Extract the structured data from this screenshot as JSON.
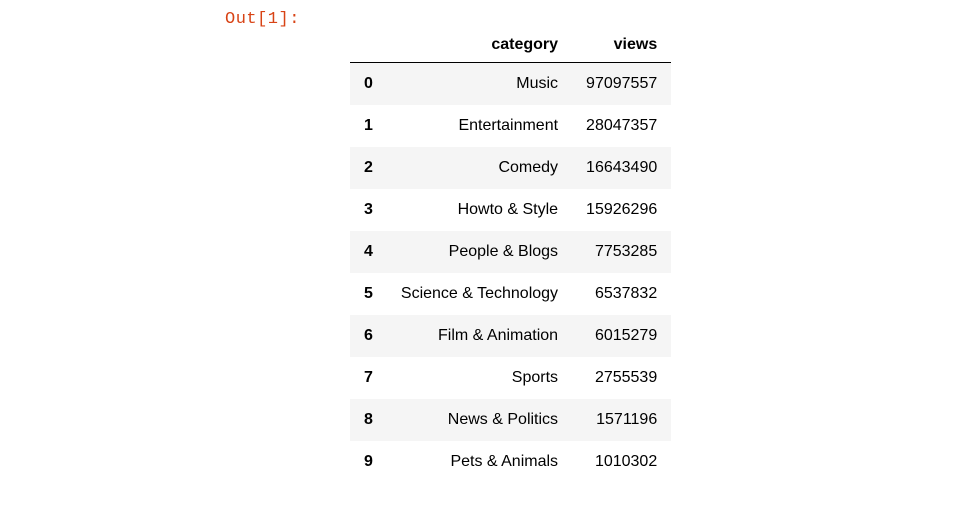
{
  "prompt": "Out[1]:",
  "table": {
    "columns": [
      "category",
      "views"
    ],
    "rows": [
      {
        "index": "0",
        "category": "Music",
        "views": "97097557"
      },
      {
        "index": "1",
        "category": "Entertainment",
        "views": "28047357"
      },
      {
        "index": "2",
        "category": "Comedy",
        "views": "16643490"
      },
      {
        "index": "3",
        "category": "Howto & Style",
        "views": "15926296"
      },
      {
        "index": "4",
        "category": "People & Blogs",
        "views": "7753285"
      },
      {
        "index": "5",
        "category": "Science & Technology",
        "views": "6537832"
      },
      {
        "index": "6",
        "category": "Film & Animation",
        "views": "6015279"
      },
      {
        "index": "7",
        "category": "Sports",
        "views": "2755539"
      },
      {
        "index": "8",
        "category": "News & Politics",
        "views": "1571196"
      },
      {
        "index": "9",
        "category": "Pets & Animals",
        "views": "1010302"
      }
    ]
  }
}
